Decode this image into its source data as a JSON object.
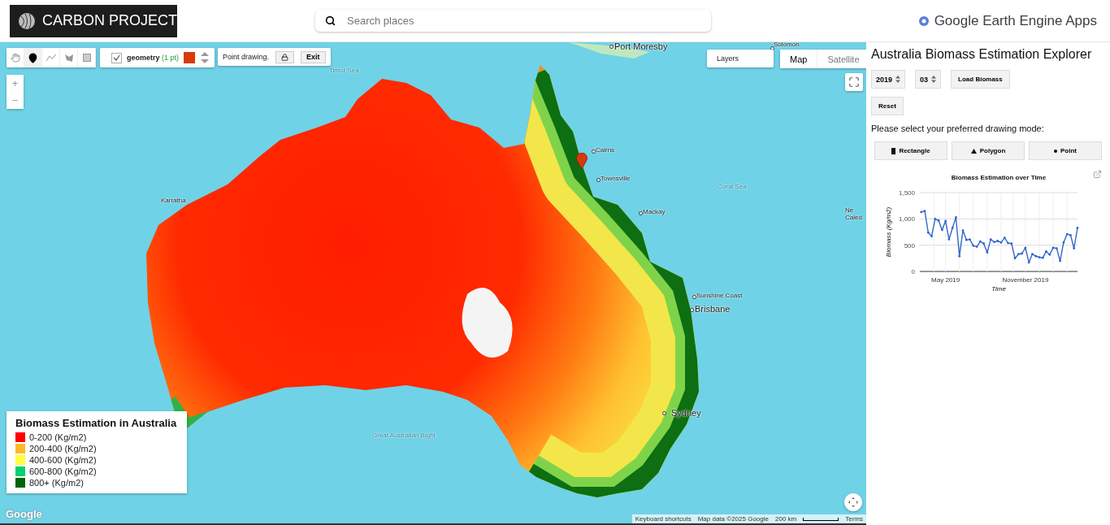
{
  "header": {
    "logo": "CARBON PROJECT",
    "search": {
      "placeholder": "Search places"
    },
    "brand": "Google Earth Engine Apps"
  },
  "map": {
    "draw_tools": [
      {
        "kind": "hand",
        "selected": false
      },
      {
        "kind": "point",
        "selected": true
      },
      {
        "kind": "line",
        "selected": false
      },
      {
        "kind": "polygon",
        "selected": false
      },
      {
        "kind": "rectangle",
        "selected": false
      }
    ],
    "geometry_layer": {
      "checked": true,
      "name": "geometry",
      "count": "(1 pt)"
    },
    "drawing_status": {
      "text": "Point drawing.",
      "exit": "Exit"
    },
    "layers_button": "Layers",
    "map_types": [
      {
        "label": "Map",
        "selected": true
      },
      {
        "label": "Satellite",
        "selected": false
      }
    ],
    "zoom": {
      "in": "+",
      "out": "−"
    },
    "places": [
      {
        "label": "Port Moresby",
        "kind": "city"
      },
      {
        "label": "Solomon",
        "kind": "town"
      },
      {
        "label": "Timor Sea",
        "kind": "sea"
      },
      {
        "label": "Cairns",
        "kind": "town"
      },
      {
        "label": "Townsville",
        "kind": "town"
      },
      {
        "label": "Coral Sea",
        "kind": "sea"
      },
      {
        "label": "Mackay",
        "kind": "town"
      },
      {
        "label": "Karratha",
        "kind": "town"
      },
      {
        "label": "Sunshine Coast",
        "kind": "town"
      },
      {
        "label": "Brisbane",
        "kind": "city"
      },
      {
        "label": "Sydney",
        "kind": "city"
      },
      {
        "label": "Great Australian Bight",
        "kind": "sea"
      },
      {
        "label": "Ne Caled",
        "kind": "region"
      }
    ],
    "legend": {
      "title": "Biomass Estimation in Australia",
      "items": [
        {
          "label": "0-200 (Kg/m2)",
          "color": "#ff0000"
        },
        {
          "label": "200-400 (Kg/m2)",
          "color": "#ffb829"
        },
        {
          "label": "400-600 (Kg/m2)",
          "color": "#ffff3d"
        },
        {
          "label": "600-800 (Kg/m2)",
          "color": "#00d06e"
        },
        {
          "label": "800+ (Kg/m2)",
          "color": "#006400"
        }
      ]
    },
    "google_logo": "Google",
    "attribution": [
      "Keyboard shortcuts",
      "Map data ©2025 Google"
    ],
    "scale": "200 km",
    "terms": "Terms"
  },
  "panel": {
    "title": "Australia Biomass Estimation Explorer",
    "year": "2019",
    "month": "03",
    "load_button": "Load Biomass",
    "reset_button": "Reset",
    "instruction": "Please select your preferred drawing mode:",
    "modes": [
      {
        "kind": "rectangle",
        "label": "Rectangle"
      },
      {
        "kind": "polygon",
        "label": "Polygon"
      },
      {
        "kind": "point",
        "label": "Point"
      }
    ],
    "chart_data": {
      "type": "line",
      "title": "Biomass Estimation over Time",
      "xlabel": "Time",
      "ylabel": "Biomass (Kg/m2)",
      "categories": [
        null,
        null,
        null,
        null,
        null,
        null,
        null,
        "May 2019",
        null,
        null,
        null,
        null,
        null,
        null,
        null,
        null,
        null,
        null,
        null,
        null,
        null,
        null,
        null,
        null,
        null,
        null,
        null,
        null,
        null,
        null,
        "November 2019",
        null,
        null,
        null,
        null,
        null,
        null,
        null,
        null,
        null,
        null,
        null,
        null,
        null,
        null,
        null
      ],
      "series": [
        {
          "color": "#3366cc",
          "values": [
            1130,
            1150,
            740,
            670,
            1000,
            970,
            790,
            960,
            610,
            830,
            1030,
            290,
            780,
            600,
            610,
            490,
            470,
            570,
            530,
            360,
            610,
            560,
            580,
            550,
            640,
            540,
            530,
            250,
            330,
            340,
            450,
            170,
            330,
            290,
            270,
            260,
            380,
            320,
            450,
            440,
            200,
            550,
            710,
            690,
            440,
            830
          ]
        }
      ],
      "ylim": [
        0,
        1500
      ],
      "grid": true,
      "yticks": [
        {
          "value": 0,
          "label": "0"
        },
        {
          "value": 500,
          "label": "500"
        },
        {
          "value": 1000,
          "label": "1,000"
        },
        {
          "value": 1500,
          "label": "1,500"
        }
      ]
    }
  }
}
